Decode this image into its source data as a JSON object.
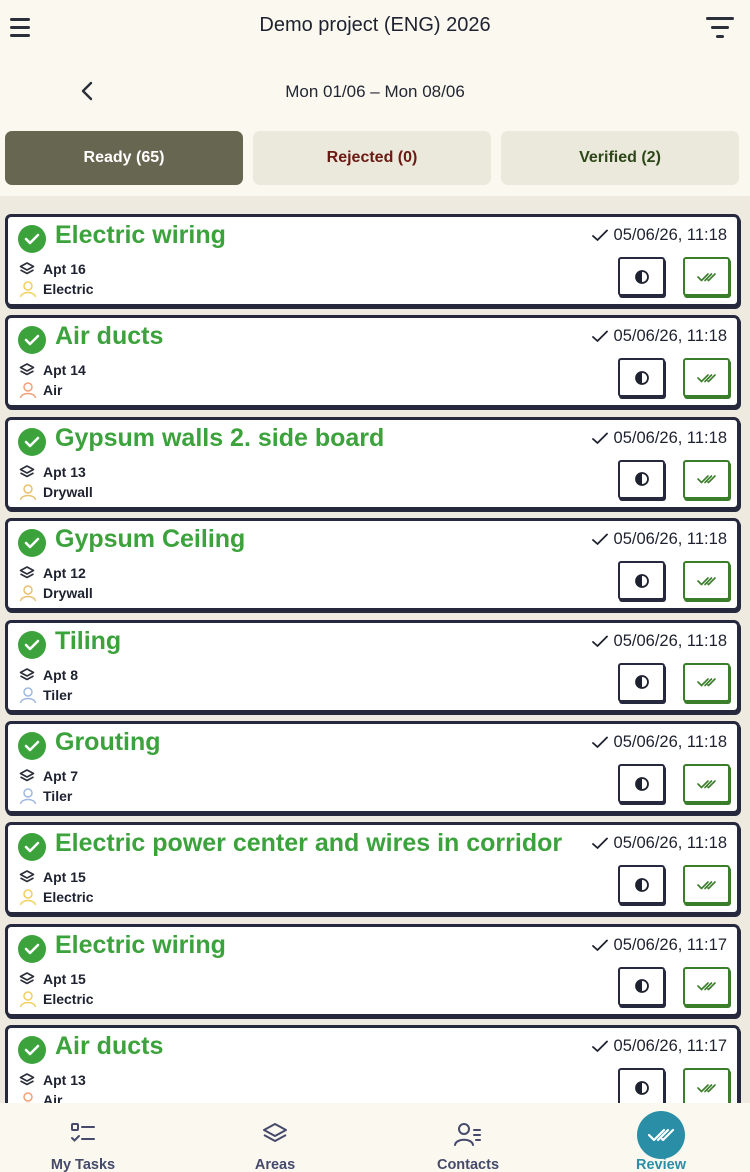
{
  "header": {
    "title": "Demo project (ENG) 2026"
  },
  "date_nav": {
    "range": "Mon 01/06 – Mon 08/06"
  },
  "tabs": [
    {
      "label": "Ready (65)",
      "active": true
    },
    {
      "label": "Rejected (0)",
      "active": false
    },
    {
      "label": "Verified (2)",
      "active": false
    }
  ],
  "tasks": [
    {
      "title": "Electric wiring",
      "timestamp": "05/06/26, 11:18",
      "area": "Apt 16",
      "trade": "Electric",
      "trade_color": "#f0d060"
    },
    {
      "title": "Air ducts",
      "timestamp": "05/06/26, 11:18",
      "area": "Apt 14",
      "trade": "Air",
      "trade_color": "#f2a07a"
    },
    {
      "title": "Gypsum walls 2. side board",
      "timestamp": "05/06/26, 11:18",
      "area": "Apt 13",
      "trade": "Drywall",
      "trade_color": "#e8c070"
    },
    {
      "title": "Gypsum Ceiling",
      "timestamp": "05/06/26, 11:18",
      "area": "Apt 12",
      "trade": "Drywall",
      "trade_color": "#e8c070"
    },
    {
      "title": "Tiling",
      "timestamp": "05/06/26, 11:18",
      "area": "Apt 8",
      "trade": "Tiler",
      "trade_color": "#a0b8e0"
    },
    {
      "title": "Grouting",
      "timestamp": "05/06/26, 11:18",
      "area": "Apt 7",
      "trade": "Tiler",
      "trade_color": "#a0b8e0"
    },
    {
      "title": "Electric power center and wires in corridor",
      "timestamp": "05/06/26, 11:18",
      "area": "Apt 15",
      "trade": "Electric",
      "trade_color": "#f0d060"
    },
    {
      "title": "Electric wiring",
      "timestamp": "05/06/26, 11:17",
      "area": "Apt 15",
      "trade": "Electric",
      "trade_color": "#f0d060"
    },
    {
      "title": "Air ducts",
      "timestamp": "05/06/26, 11:17",
      "area": "Apt 13",
      "trade": "Air",
      "trade_color": "#f2a07a"
    }
  ],
  "bottom_nav": [
    {
      "label": "My Tasks",
      "icon": "tasks-icon"
    },
    {
      "label": "Areas",
      "icon": "layers-icon"
    },
    {
      "label": "Contacts",
      "icon": "contacts-icon"
    },
    {
      "label": "Review",
      "icon": "double-check-icon",
      "active": true
    }
  ],
  "colors": {
    "accent_green": "#3ca23c",
    "review_blue": "#2a8fa6",
    "active_tab": "#676650"
  }
}
